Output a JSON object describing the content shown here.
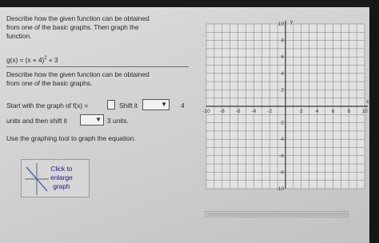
{
  "question": {
    "prompt_line1": "Describe how the given function can be obtained",
    "prompt_line2": "from one of the basic graphs. Then graph the",
    "prompt_line3": "function.",
    "equation_base": "g(x) = (x + 4)",
    "equation_exp": "2",
    "equation_tail": " + 3",
    "sub_prompt_line1": "Describe how the given function can be obtained",
    "sub_prompt_line2": "from one of the basic graphs.",
    "start_text": "Start with the graph of f(x) =",
    "shift_label": "Shift it",
    "shift_value": "4",
    "units_then_label": "units and then shift it",
    "units_tail": "3 units.",
    "tool_instruction": "Use the graphing tool to graph the equation.",
    "enlarge_line1": "Click to",
    "enlarge_line2": "enlarge",
    "enlarge_line3": "graph"
  },
  "graph": {
    "y_axis_label": "y",
    "x_axis_label": "x",
    "x_ticks": [
      "-10",
      "-8",
      "-6",
      "-4",
      "-2",
      "2",
      "4",
      "6",
      "8",
      "10"
    ],
    "y_ticks": [
      "10",
      "8",
      "6",
      "4",
      "2",
      "-2",
      "-4",
      "-6",
      "-8",
      "-10"
    ],
    "range": [
      -10,
      10
    ],
    "grid_color": "#7b7b7b"
  }
}
